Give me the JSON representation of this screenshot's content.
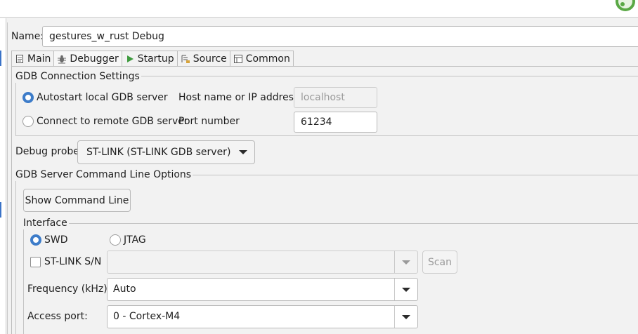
{
  "name": {
    "label": "Name:",
    "value": "gestures_w_rust Debug"
  },
  "tabs": [
    {
      "label": "Main",
      "icon": "document-icon"
    },
    {
      "label": "Debugger",
      "icon": "bug-icon"
    },
    {
      "label": "Startup",
      "icon": "play-icon"
    },
    {
      "label": "Source",
      "icon": "source-lookup-icon"
    },
    {
      "label": "Common",
      "icon": "common-table-icon"
    }
  ],
  "active_tab": "Debugger",
  "gdb_connection": {
    "title": "GDB Connection Settings",
    "autostart_label": "Autostart local GDB server",
    "connect_remote_label": "Connect to remote GDB server",
    "host_label": "Host name or IP address",
    "host_value": "localhost",
    "port_label": "Port number",
    "port_value": "61234",
    "selected": "autostart"
  },
  "debug_probe": {
    "label": "Debug probe",
    "value": "ST-LINK (ST-LINK GDB server)"
  },
  "server_options": {
    "title": "GDB Server Command Line Options",
    "show_command_line": "Show Command Line",
    "interface": {
      "title": "Interface",
      "swd_label": "SWD",
      "jtag_label": "JTAG",
      "selected": "SWD"
    },
    "stlink_sn": {
      "label": "ST-LINK S/N",
      "value": "",
      "checked": false,
      "scan_label": "Scan"
    },
    "frequency": {
      "label": "Frequency (kHz):",
      "value": "Auto"
    },
    "access_port": {
      "label": "Access port:",
      "value": "0 - Cortex-M4"
    }
  },
  "colors": {
    "accent": "#3d7cc9",
    "background": "#f2f2f2",
    "border": "#b9b9b9"
  }
}
